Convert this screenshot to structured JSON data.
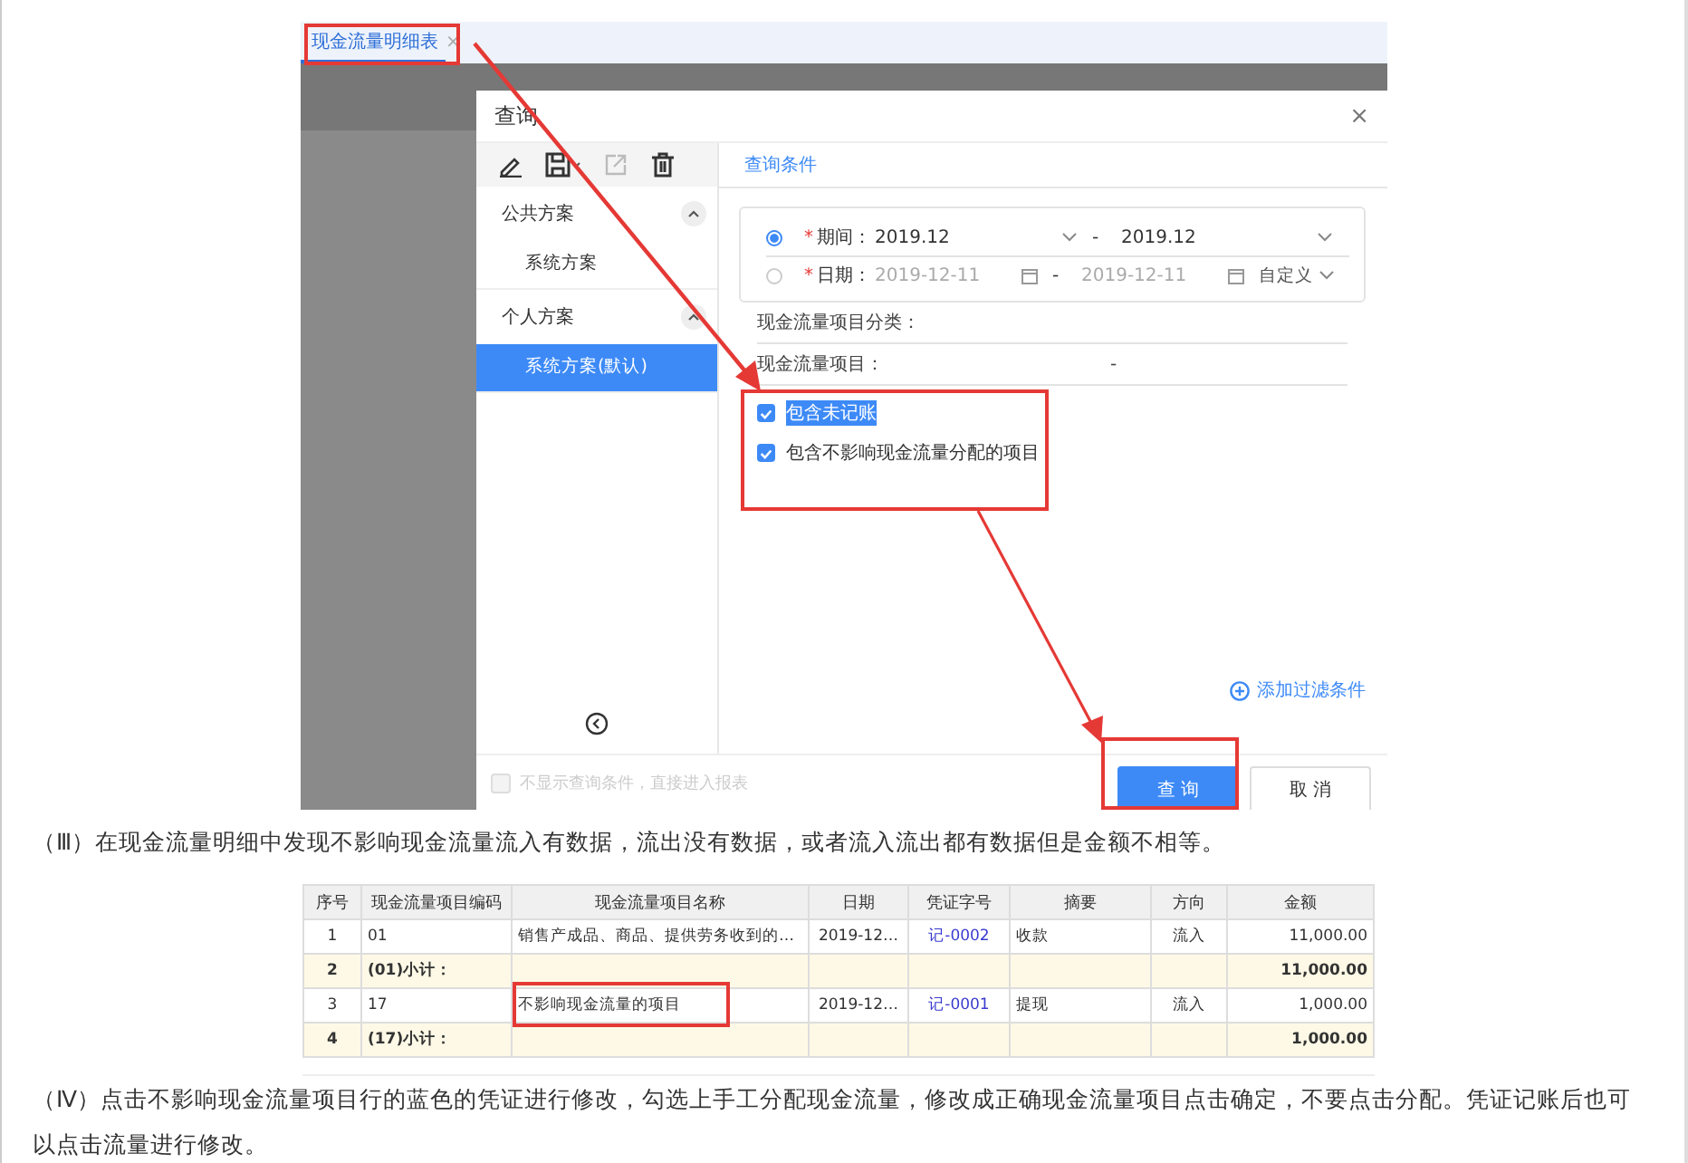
{
  "report_tab": {
    "label": "现金流量明细表",
    "close": "×",
    "selected": true
  },
  "dialog": {
    "title": "查询",
    "close": "×",
    "scheme_groups": [
      {
        "label": "公共方案",
        "expanded": true,
        "items": [
          {
            "label": "系统方案",
            "selected": false
          }
        ]
      },
      {
        "label": "个人方案",
        "expanded": true,
        "items": [
          {
            "label": "系统方案(默认)",
            "selected": true
          }
        ]
      }
    ],
    "condition_tab": "查询条件",
    "ranges": [
      {
        "kind": "select",
        "selected": true,
        "required_mark": "*",
        "label": "期间：",
        "from": "2019.12",
        "separator": "-",
        "to": "2019.12"
      },
      {
        "kind": "date",
        "selected": false,
        "required_mark": "*",
        "label": "日期：",
        "from": "2019-12-11",
        "separator": "-",
        "to": "2019-12-11",
        "mode": "自定义"
      }
    ],
    "fields": [
      {
        "label": "现金流量项目分类："
      },
      {
        "label": "现金流量项目：",
        "value": "-"
      }
    ],
    "options": [
      {
        "label": "包含未记账",
        "checked": true,
        "highlighted": true
      },
      {
        "label": "包含不影响现金流量分配的项目",
        "checked": true,
        "highlighted": false
      }
    ],
    "add_filter": "添加过滤条件",
    "skip_option": {
      "label": "不显示查询条件，直接进入报表",
      "checked": false,
      "disabled": true
    },
    "buttons": [
      {
        "label": "查 询",
        "primary": true
      },
      {
        "label": "取 消",
        "primary": false
      }
    ]
  },
  "paragraph_3": "（Ⅲ）在现金流量明细中发现不影响现金流量流入有数据，流出没有数据，或者流入流出都有数据但是金额不相等。",
  "table": {
    "columns": [
      "序号",
      "现金流量项目编码",
      "现金流量项目名称",
      "日期",
      "凭证字号",
      "摘要",
      "方向",
      "金额"
    ],
    "rows": [
      {
        "kind": "entry",
        "cells": [
          "1",
          "01",
          "销售产成品、商品、提供劳务收到的…",
          "2019-12…",
          "记-0002",
          "收款",
          "流入",
          "11,000.00"
        ]
      },
      {
        "kind": "subtotal",
        "cells": [
          "2",
          "(01)小计：",
          "",
          "",
          "",
          "",
          "",
          "11,000.00"
        ]
      },
      {
        "kind": "entry",
        "cells": [
          "3",
          "17",
          "不影响现金流量的项目",
          "2019-12…",
          "记-0001",
          "提现",
          "流入",
          "1,000.00"
        ]
      },
      {
        "kind": "subtotal",
        "cells": [
          "4",
          "(17)小计：",
          "",
          "",
          "",
          "",
          "",
          "1,000.00"
        ]
      }
    ]
  },
  "paragraph_4": "（Ⅳ）点击不影响现金流量项目行的蓝色的凭证进行修改，勾选上手工分配现金流量，修改成正确现金流量项目点击确定，不要点击分配。凭证记账后也可以点击流量进行修改。"
}
